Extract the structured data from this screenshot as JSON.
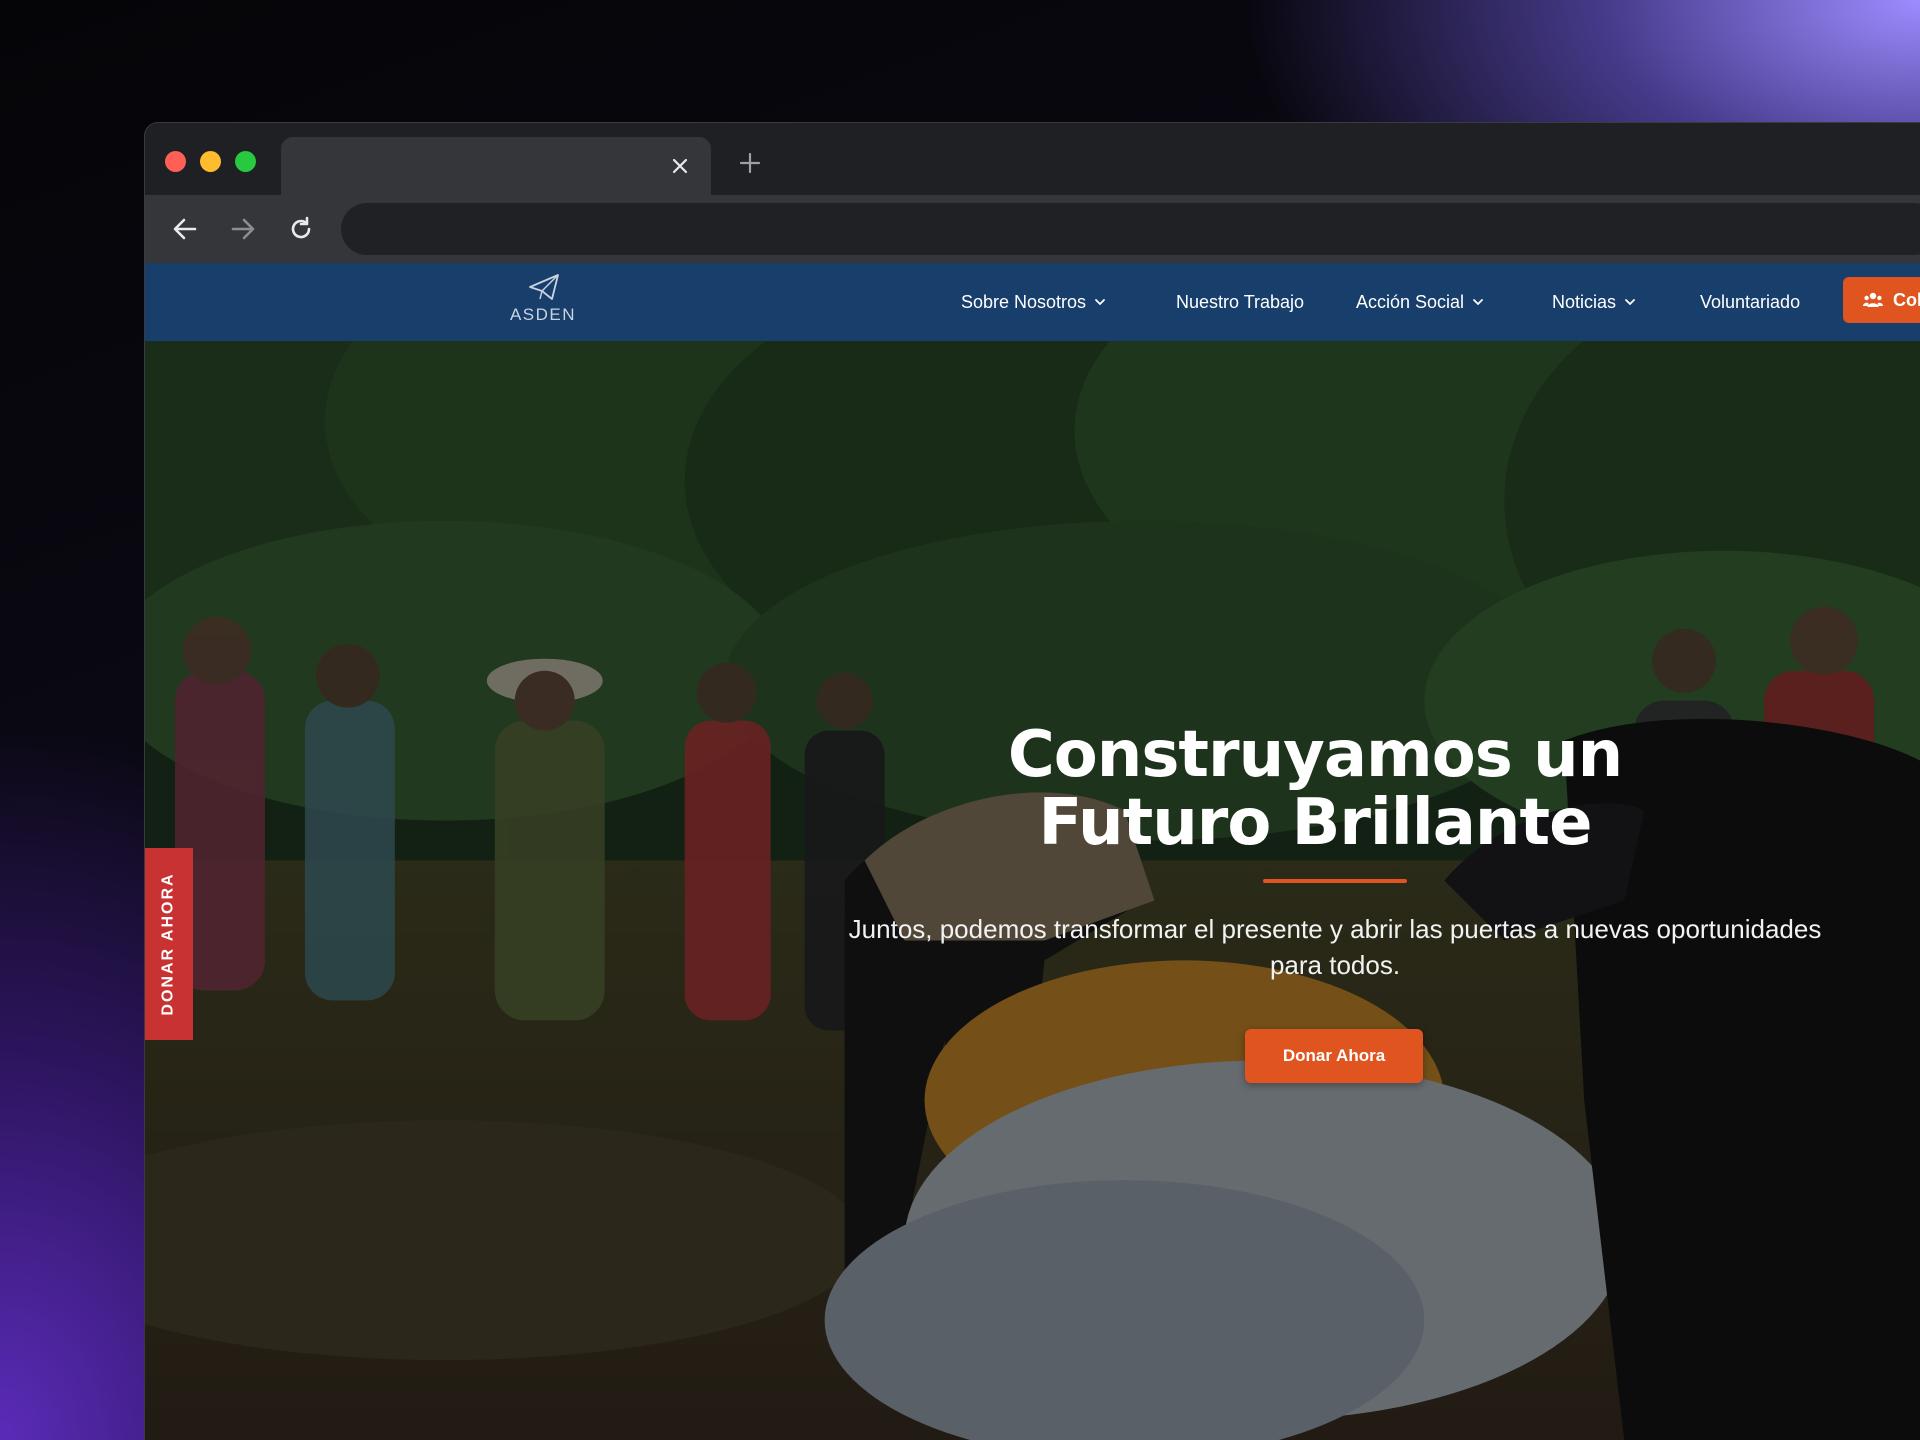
{
  "browser": {
    "tab_title": "",
    "address": "",
    "icons": {
      "close": "close-icon",
      "new_tab": "plus-icon",
      "back": "arrow-left-icon",
      "forward": "arrow-right-icon",
      "reload": "reload-icon"
    },
    "colors": {
      "close_dot": "#ff5f57",
      "minimize_dot": "#febc2e",
      "zoom_dot": "#28c840"
    }
  },
  "site": {
    "logo_text": "ASDEN",
    "nav": [
      {
        "label": "Sobre Nosotros",
        "has_dropdown": true
      },
      {
        "label": "Nuestro Trabajo",
        "has_dropdown": false
      },
      {
        "label": "Acción Social",
        "has_dropdown": true
      },
      {
        "label": "Noticias",
        "has_dropdown": true
      },
      {
        "label": "Voluntariado",
        "has_dropdown": false
      }
    ],
    "cta_label": "Col",
    "cta_icon": "users-icon",
    "header_color": "#183e6b",
    "accent_color": "#e0541f"
  },
  "hero": {
    "title": "Construyamos un Futuro Brillante",
    "subtitle": "Juntos, podemos transformar el presente y abrir las puertas a nuevas oportunidades para todos.",
    "button_label": "Donar Ahora"
  },
  "side_tab": {
    "label": "DONAR AHORA",
    "color": "#c93232"
  }
}
